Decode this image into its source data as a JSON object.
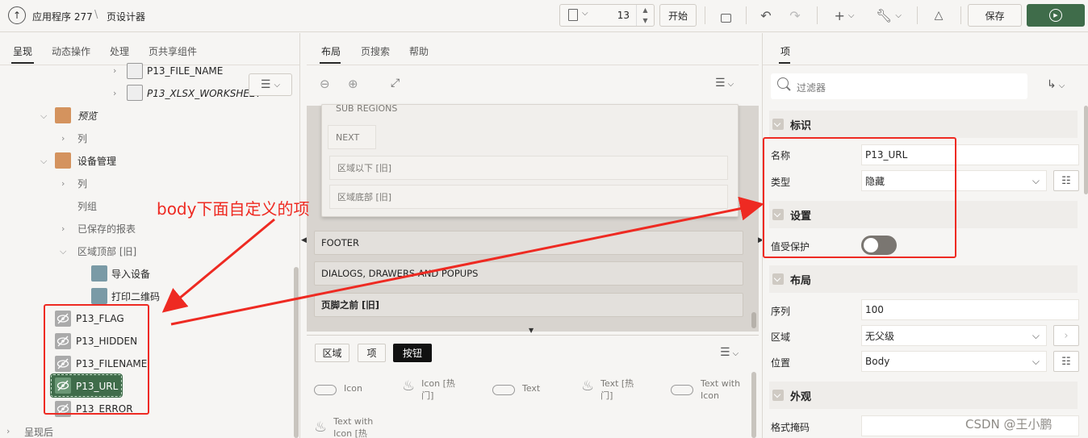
{
  "topbar": {
    "app_name": "应用程序 277",
    "separator": "\\",
    "page_designer": "页设计器",
    "page_number": "13",
    "go_label": "开始",
    "save_label": "保存"
  },
  "left": {
    "tabs": [
      "呈现",
      "动态操作",
      "处理",
      "页共享组件"
    ],
    "tree": {
      "file_name": "P13_FILE_NAME",
      "xlsx": "P13_XLSX_WORKSHEET",
      "preview": "预览",
      "col1": "列",
      "device_mgmt": "设备管理",
      "col2": "列",
      "col_group": "列组",
      "saved_reports": "已保存的报表",
      "region_top": "区域顶部 [旧]",
      "import_device": "导入设备",
      "print_qr": "打印二维码",
      "items": [
        "P13_FLAG",
        "P13_HIDDEN",
        "P13_FILENAME",
        "P13_URL",
        "P13_ERROR"
      ],
      "after_render": "呈现后"
    }
  },
  "middle": {
    "tabs": [
      "布局",
      "页搜索",
      "帮助"
    ],
    "canvas": {
      "sub_regions": "SUB REGIONS",
      "next": "NEXT",
      "region_below": "区域以下 [旧]",
      "region_bottom": "区域底部 [旧]",
      "footer": "FOOTER",
      "dialogs": "DIALOGS, DRAWERS AND POPUPS",
      "before_footer": "页脚之前 [旧]"
    },
    "gallery_tabs": [
      "区域",
      "项",
      "按钮"
    ],
    "gallery": {
      "icon": "Icon",
      "icon_hot": "Icon [热门]",
      "text": "Text",
      "text_hot": "Text [热门]",
      "text_with_icon": "Text with Icon",
      "text_with_icon_hot": "Text with Icon [热"
    }
  },
  "right": {
    "tab": "项",
    "filter_placeholder": "过滤器",
    "sections": {
      "identification": "标识",
      "settings": "设置",
      "layout": "布局",
      "appearance": "外观"
    },
    "props": {
      "name_label": "名称",
      "name_value": "P13_URL",
      "type_label": "类型",
      "type_value": "隐藏",
      "protected_label": "值受保护",
      "sequence_label": "序列",
      "sequence_value": "100",
      "region_label": "区域",
      "region_value": "无父级",
      "position_label": "位置",
      "position_value": "Body",
      "format_mask_label": "格式掩码"
    }
  },
  "annotation": {
    "label": "body下面自定义的项",
    "watermark": "CSDN @王小鹏"
  },
  "colors": {
    "primary_green": "#3f6c4a",
    "selected_item": "#3f6c4a",
    "annotation_red": "#ee2a22"
  }
}
